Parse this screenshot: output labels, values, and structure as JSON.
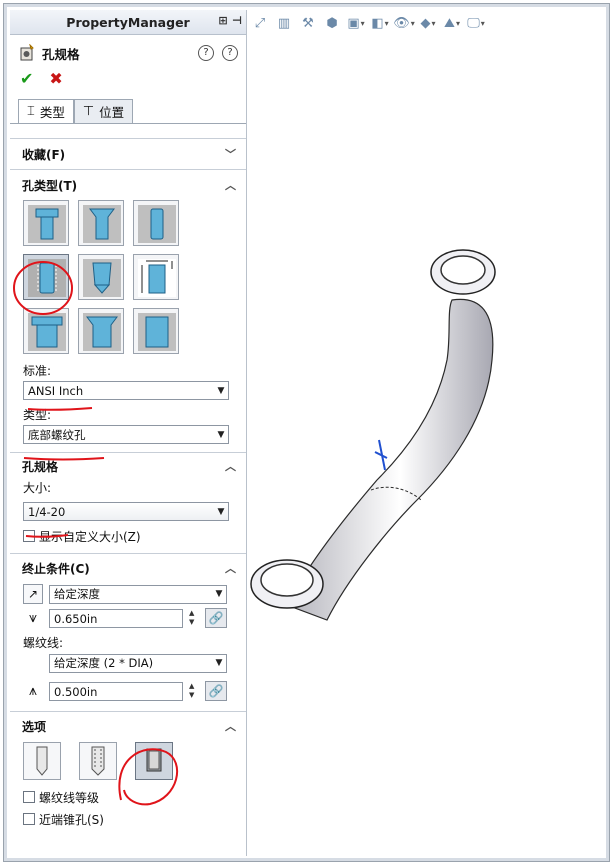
{
  "panel": {
    "title": "PropertyManager",
    "feature_name": "孔规格",
    "help_glyph": "?",
    "info_glyph": "?",
    "ok_glyph": "✔",
    "cancel_glyph": "✖"
  },
  "tabs": [
    {
      "label": "类型",
      "active": true
    },
    {
      "label": "位置",
      "active": false
    }
  ],
  "sections": {
    "favorites": {
      "title": "收藏(F)"
    },
    "hole_type": {
      "title": "孔类型(T)",
      "standard_label": "标准:",
      "standard_value": "ANSI Inch",
      "type_label": "类型:",
      "type_value": "底部螺纹孔"
    },
    "hole_spec": {
      "title": "孔规格",
      "size_label": "大小:",
      "size_value": "1/4-20",
      "custom_size_label": "显示自定义大小(Z)"
    },
    "end_condition": {
      "title": "终止条件(C)",
      "condition_value": "给定深度",
      "depth_value": "0.650in",
      "thread_label": "螺纹线:",
      "thread_condition_value": "给定深度 (2 * DIA)",
      "thread_depth_value": "0.500in"
    },
    "options": {
      "title": "选项",
      "thread_class_label": "螺纹线等级",
      "near_countersink_label": "近端锥孔(S)"
    }
  },
  "colors": {
    "accent": "#1e73c9",
    "annotation_red": "#e0141a",
    "panel_border": "#9aa3ad"
  }
}
